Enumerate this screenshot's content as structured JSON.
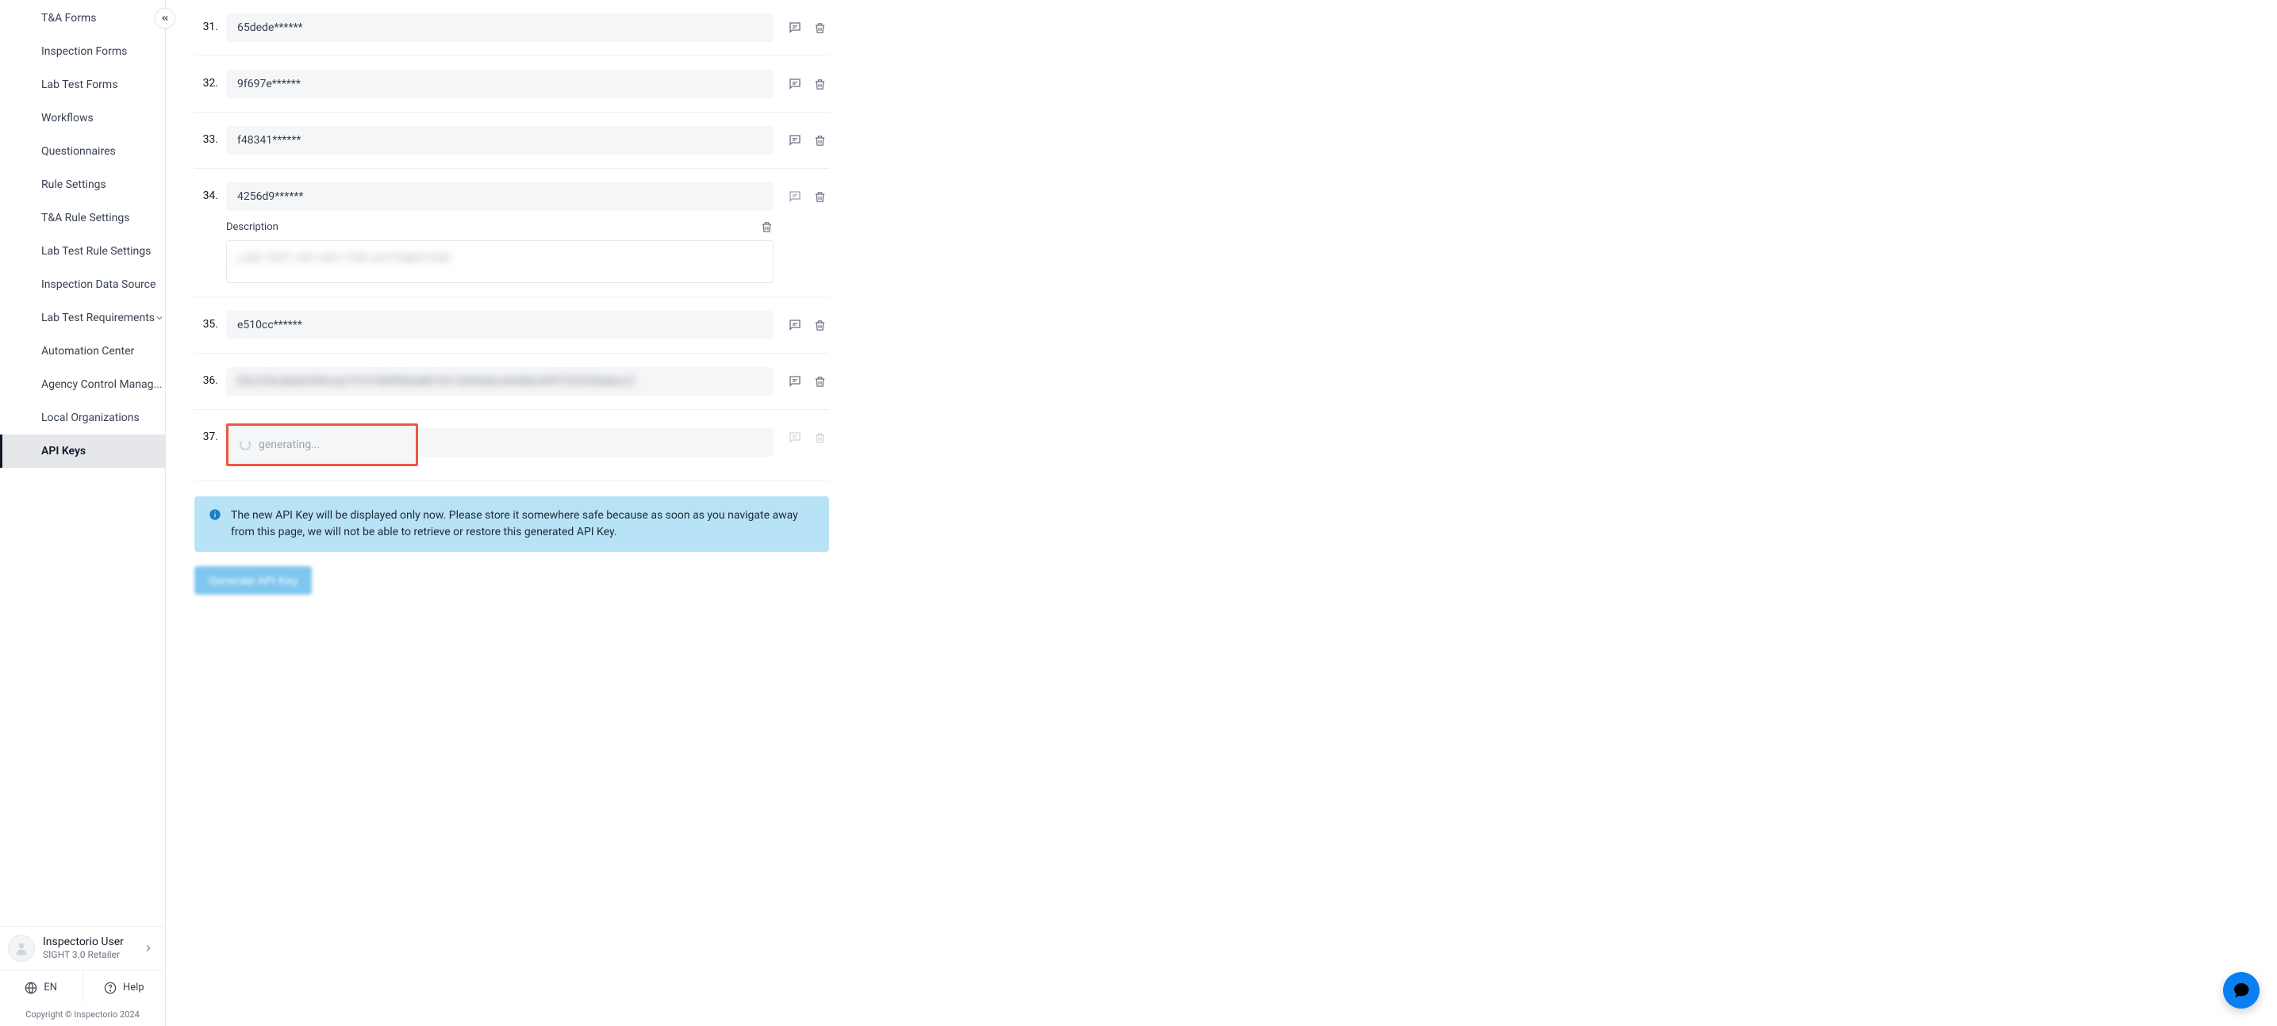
{
  "sidebar": {
    "items": [
      {
        "label": "T&A Forms"
      },
      {
        "label": "Inspection Forms"
      },
      {
        "label": "Lab Test Forms"
      },
      {
        "label": "Workflows"
      },
      {
        "label": "Questionnaires"
      },
      {
        "label": "Rule Settings"
      },
      {
        "label": "T&A Rule Settings"
      },
      {
        "label": "Lab Test Rule Settings"
      },
      {
        "label": "Inspection Data Source"
      },
      {
        "label": "Lab Test Requirements",
        "has_children": true
      },
      {
        "label": "Automation Center"
      },
      {
        "label": "Agency Control Manag..."
      },
      {
        "label": "Local Organizations"
      },
      {
        "label": "API Keys",
        "active": true
      }
    ]
  },
  "user": {
    "name": "Inspectorio User",
    "role": "SIGHT 3.0 Retailer"
  },
  "footer": {
    "lang": "EN",
    "help": "Help",
    "copyright": "Copyright © Inspectorio 2024"
  },
  "keys": [
    {
      "index": "31.",
      "value": "65dede******"
    },
    {
      "index": "32.",
      "value": "9f697e******"
    },
    {
      "index": "33.",
      "value": "f48341******"
    },
    {
      "index": "34.",
      "value": "4256d9******",
      "desc_open": true,
      "desc_label": "Description",
      "desc_value": "LAB TEST API KEY FOR AUTOMATION"
    },
    {
      "index": "35.",
      "value": "e510cc******"
    },
    {
      "index": "36.",
      "value": "03c47bc6be6340caa191b7889fb0a8b7dc1e84e0bc4e48ecbf4723323bdecc2",
      "blur": true
    },
    {
      "index": "37.",
      "value": "generating...",
      "generating": true,
      "highlighted": true,
      "disabled_actions": true
    }
  ],
  "alert": {
    "text": "The new API Key will be displayed only now. Please store it somewhere safe because as soon as you navigate away from this page, we will not be able to retrieve or restore this generated API Key."
  },
  "generate_button": "Generate API Key"
}
